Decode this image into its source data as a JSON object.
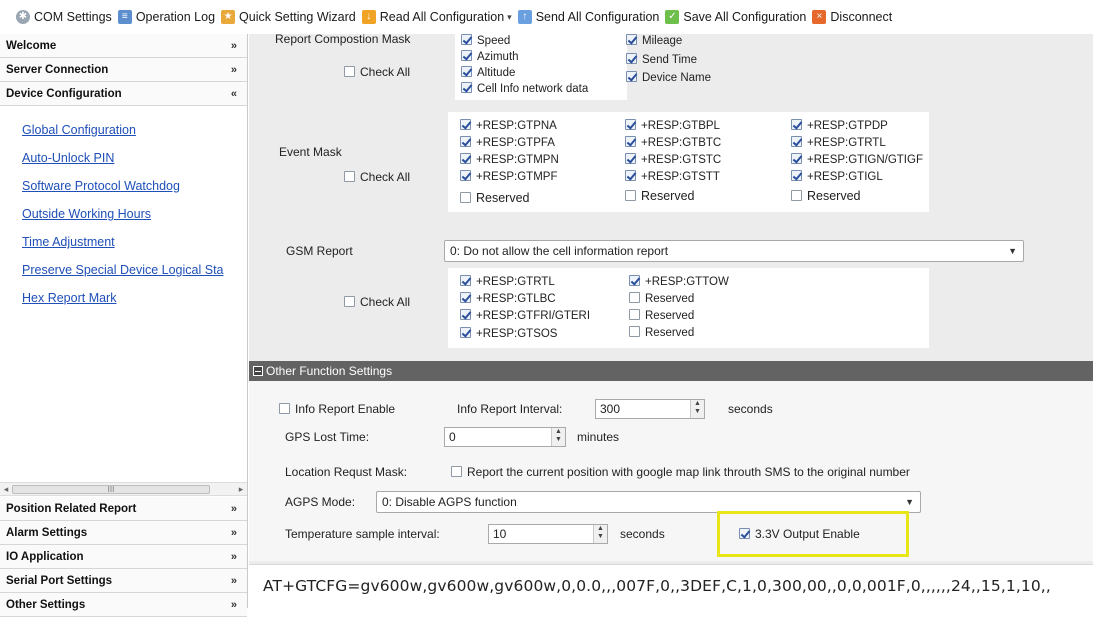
{
  "toolbar": {
    "items": [
      {
        "label": "COM Settings",
        "icon": "gear-icon"
      },
      {
        "label": "Operation Log",
        "icon": "log-icon"
      },
      {
        "label": "Quick Setting Wizard",
        "icon": "wizard-icon"
      },
      {
        "label": "Read All Configuration",
        "icon": "read-config-icon",
        "has_dropdown": true
      },
      {
        "label": "Send All Configuration",
        "icon": "send-config-icon"
      },
      {
        "label": "Save All Configuration",
        "icon": "save-config-icon"
      },
      {
        "label": "Disconnect",
        "icon": "disconnect-icon"
      }
    ]
  },
  "sidebar": {
    "top_sections": [
      {
        "label": "Welcome",
        "chevron": "»"
      },
      {
        "label": "Server Connection",
        "chevron": "»"
      },
      {
        "label": "Device Configuration",
        "chevron": "«",
        "expanded": true
      }
    ],
    "links": [
      "Global Configuration",
      "Auto-Unlock PIN",
      "Software Protocol Watchdog",
      "Outside Working Hours",
      "Time Adjustment",
      "Preserve Special Device Logical Sta",
      "Hex Report Mark"
    ],
    "scroll_thumb": "III",
    "bottom_sections": [
      {
        "label": "Position Related Report",
        "chevron": "»"
      },
      {
        "label": "Alarm Settings",
        "chevron": "»"
      },
      {
        "label": "IO Application",
        "chevron": "»"
      },
      {
        "label": "Serial Port Settings",
        "chevron": "»"
      },
      {
        "label": "Other Settings",
        "chevron": "»"
      }
    ]
  },
  "report_composition": {
    "label": "Report Compostion Mask",
    "check_all": "Check All",
    "options": [
      {
        "label": "Speed",
        "checked": true
      },
      {
        "label": "Mileage",
        "checked": true
      },
      {
        "label": "Azimuth",
        "checked": true
      },
      {
        "label": "Send Time",
        "checked": true
      },
      {
        "label": "Altitude",
        "checked": true
      },
      {
        "label": "Device Name",
        "checked": true
      },
      {
        "label": "Cell Info network data",
        "checked": true
      }
    ]
  },
  "event_mask": {
    "label": "Event Mask",
    "check_all": "Check All",
    "col1": [
      "+RESP:GTPNA",
      "+RESP:GTPFA",
      "+RESP:GTMPN",
      "+RESP:GTMPF",
      "Reserved"
    ],
    "col2": [
      "+RESP:GTBPL",
      "+RESP:GTBTC",
      "+RESP:GTSTC",
      "+RESP:GTSTT",
      "Reserved"
    ],
    "col3": [
      "+RESP:GTPDP",
      "+RESP:GTRTL",
      "+RESP:GTIGN/GTIGF",
      "+RESP:GTIGL",
      "Reserved"
    ]
  },
  "gsm_report": {
    "label": "GSM Report",
    "selected": "0: Do not allow the cell information report",
    "check_all": "Check All",
    "col1": [
      "+RESP:GTRTL",
      "+RESP:GTLBC",
      "+RESP:GTFRI/GTERI",
      "+RESP:GTSOS"
    ],
    "col2": [
      "+RESP:GTTOW",
      "Reserved",
      "Reserved",
      "Reserved"
    ]
  },
  "other_functions": {
    "header": "Other Function Settings",
    "info_report_enable": "Info Report Enable",
    "info_report_interval_label": "Info Report Interval:",
    "info_report_interval": "300",
    "seconds": "seconds",
    "gps_lost_label": "GPS Lost Time:",
    "gps_lost_value": "0",
    "minutes": "minutes",
    "location_mask_label": "Location Requst Mask:",
    "location_mask_option": "Report the current position with google map link throuth SMS to the original number",
    "agps_label": "AGPS Mode:",
    "agps_selected": "0: Disable AGPS function",
    "temp_label": "Temperature sample interval:",
    "temp_value": "10",
    "temp_unit": "seconds",
    "output_enable": "3.3V Output Enable",
    "highlight_color": "#e8e616"
  },
  "command_string": "AT+GTCFG=gv600w,gv600w,gv600w,0,0.0,,,007F,0,,3DEF,C,1,0,300,00,,0,0,001F,0,,,,,,24,,15,1,10,,"
}
